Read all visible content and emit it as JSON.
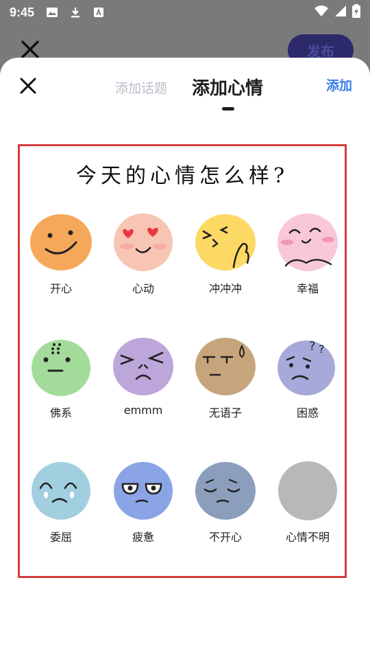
{
  "status_bar": {
    "time": "9:45"
  },
  "background": {
    "publish_label": "发布"
  },
  "sheet": {
    "tab_topic": "添加话题",
    "tab_mood": "添加心情",
    "add_label": "添加",
    "panel_title": "今天的心情怎么样?"
  },
  "moods": [
    {
      "label": "开心",
      "color": "#f6a85a"
    },
    {
      "label": "心动",
      "color": "#f8c5b5"
    },
    {
      "label": "冲冲冲",
      "color": "#fcd964"
    },
    {
      "label": "幸福",
      "color": "#f8c7da"
    },
    {
      "label": "佛系",
      "color": "#a3dc9a"
    },
    {
      "label": "emmm",
      "color": "#bca6da"
    },
    {
      "label": "无语子",
      "color": "#c7a57c"
    },
    {
      "label": "困惑",
      "color": "#a7a9da"
    },
    {
      "label": "委屈",
      "color": "#a2cfdf"
    },
    {
      "label": "疲惫",
      "color": "#8aa4e6"
    },
    {
      "label": "不开心",
      "color": "#8b9ebc"
    },
    {
      "label": "心情不明",
      "color": "#b8b8b8"
    }
  ],
  "colors": {
    "accent": "#3a7be8",
    "panel_border": "#d63c3c"
  },
  "icons": [
    "close-icon",
    "image-icon",
    "download-icon",
    "font-icon",
    "wifi-icon",
    "signal-icon",
    "battery-icon"
  ]
}
